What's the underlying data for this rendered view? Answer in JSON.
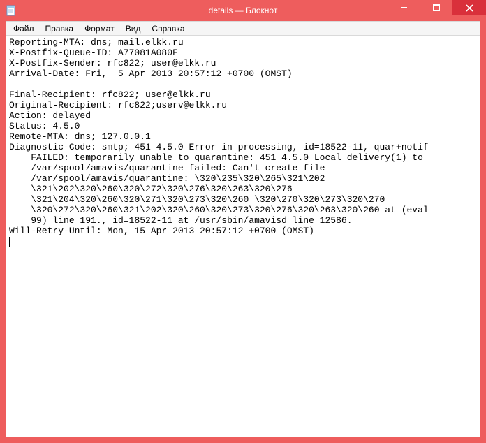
{
  "window": {
    "title": "details — Блокнот"
  },
  "menu": {
    "file": "Файл",
    "edit": "Правка",
    "format": "Формат",
    "view": "Вид",
    "help": "Справка"
  },
  "document": {
    "text": "Reporting-MTA: dns; mail.elkk.ru\nX-Postfix-Queue-ID: A77081A080F\nX-Postfix-Sender: rfc822; user@elkk.ru\nArrival-Date: Fri,  5 Apr 2013 20:57:12 +0700 (OMST)\n\nFinal-Recipient: rfc822; user@elkk.ru\nOriginal-Recipient: rfc822;userv@elkk.ru\nAction: delayed\nStatus: 4.5.0\nRemote-MTA: dns; 127.0.0.1\nDiagnostic-Code: smtp; 451 4.5.0 Error in processing, id=18522-11, quar+notif\n    FAILED: temporarily unable to quarantine: 451 4.5.0 Local delivery(1) to\n    /var/spool/amavis/quarantine failed: Can't create file\n    /var/spool/amavis/quarantine: \\320\\235\\320\\265\\321\\202\n    \\321\\202\\320\\260\\320\\272\\320\\276\\320\\263\\320\\276\n    \\321\\204\\320\\260\\320\\271\\320\\273\\320\\260 \\320\\270\\320\\273\\320\\270\n    \\320\\272\\320\\260\\321\\202\\320\\260\\320\\273\\320\\276\\320\\263\\320\\260 at (eval\n    99) line 191., id=18522-11 at /usr/sbin/amavisd line 12586.\nWill-Retry-Until: Mon, 15 Apr 2013 20:57:12 +0700 (OMST)\n"
  }
}
